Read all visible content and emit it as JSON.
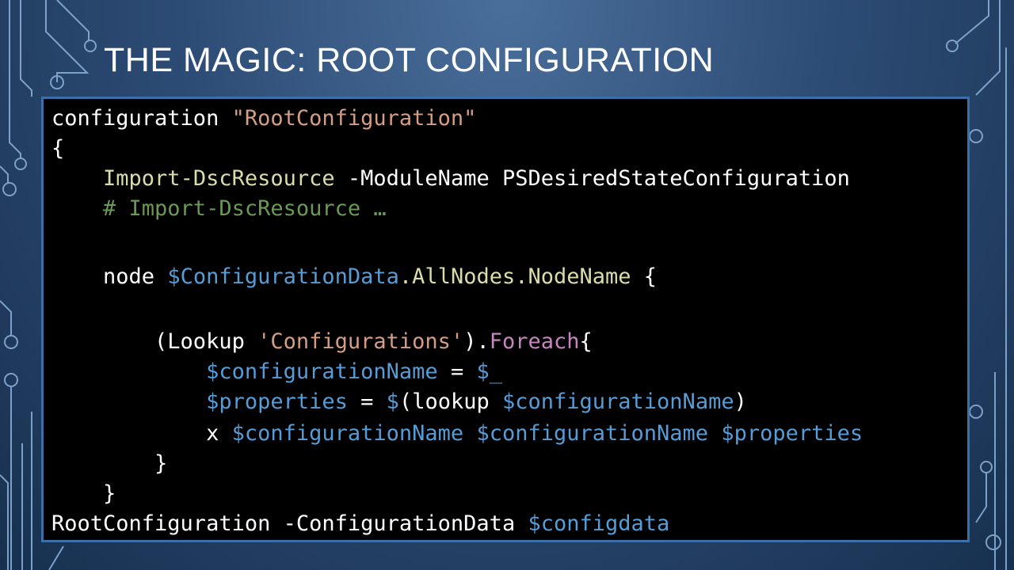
{
  "slide": {
    "title": "THE MAGIC: ROOT CONFIGURATION"
  },
  "code": {
    "lines": [
      [
        {
          "t": "configuration ",
          "c": "kw"
        },
        {
          "t": "\"RootConfiguration\"",
          "c": "str"
        }
      ],
      [
        {
          "t": "{",
          "c": "kw"
        }
      ],
      [
        {
          "t": "    ",
          "c": "kw"
        },
        {
          "t": "Import-DscResource",
          "c": "cmd"
        },
        {
          "t": " -ModuleName PSDesiredStateConfiguration",
          "c": "kw"
        }
      ],
      [
        {
          "t": "    # Import-DscResource …",
          "c": "cmt"
        }
      ],
      [],
      [
        {
          "t": "    node ",
          "c": "kw"
        },
        {
          "t": "$ConfigurationData",
          "c": "var"
        },
        {
          "t": ".AllNodes.NodeName",
          "c": "cmd"
        },
        {
          "t": " {",
          "c": "kw"
        }
      ],
      [],
      [
        {
          "t": "        (Lookup ",
          "c": "kw"
        },
        {
          "t": "'Configurations'",
          "c": "str"
        },
        {
          "t": ").",
          "c": "kw"
        },
        {
          "t": "Foreach",
          "c": "mth"
        },
        {
          "t": "{",
          "c": "kw"
        }
      ],
      [
        {
          "t": "            ",
          "c": "kw"
        },
        {
          "t": "$configurationName",
          "c": "var"
        },
        {
          "t": " = ",
          "c": "kw"
        },
        {
          "t": "$_",
          "c": "var"
        }
      ],
      [
        {
          "t": "            ",
          "c": "kw"
        },
        {
          "t": "$properties",
          "c": "var"
        },
        {
          "t": " = ",
          "c": "kw"
        },
        {
          "t": "$",
          "c": "var"
        },
        {
          "t": "(lookup ",
          "c": "kw"
        },
        {
          "t": "$configurationName",
          "c": "var"
        },
        {
          "t": ")",
          "c": "kw"
        }
      ],
      [
        {
          "t": "            x ",
          "c": "kw"
        },
        {
          "t": "$configurationName",
          "c": "var"
        },
        {
          "t": " ",
          "c": "kw"
        },
        {
          "t": "$configurationName",
          "c": "var"
        },
        {
          "t": " ",
          "c": "kw"
        },
        {
          "t": "$properties",
          "c": "var"
        }
      ],
      [
        {
          "t": "        }",
          "c": "kw"
        }
      ],
      [
        {
          "t": "    }",
          "c": "kw"
        }
      ],
      [
        {
          "t": "RootConfiguration -ConfigurationData ",
          "c": "kw"
        },
        {
          "t": "$configdata",
          "c": "var"
        }
      ]
    ]
  }
}
